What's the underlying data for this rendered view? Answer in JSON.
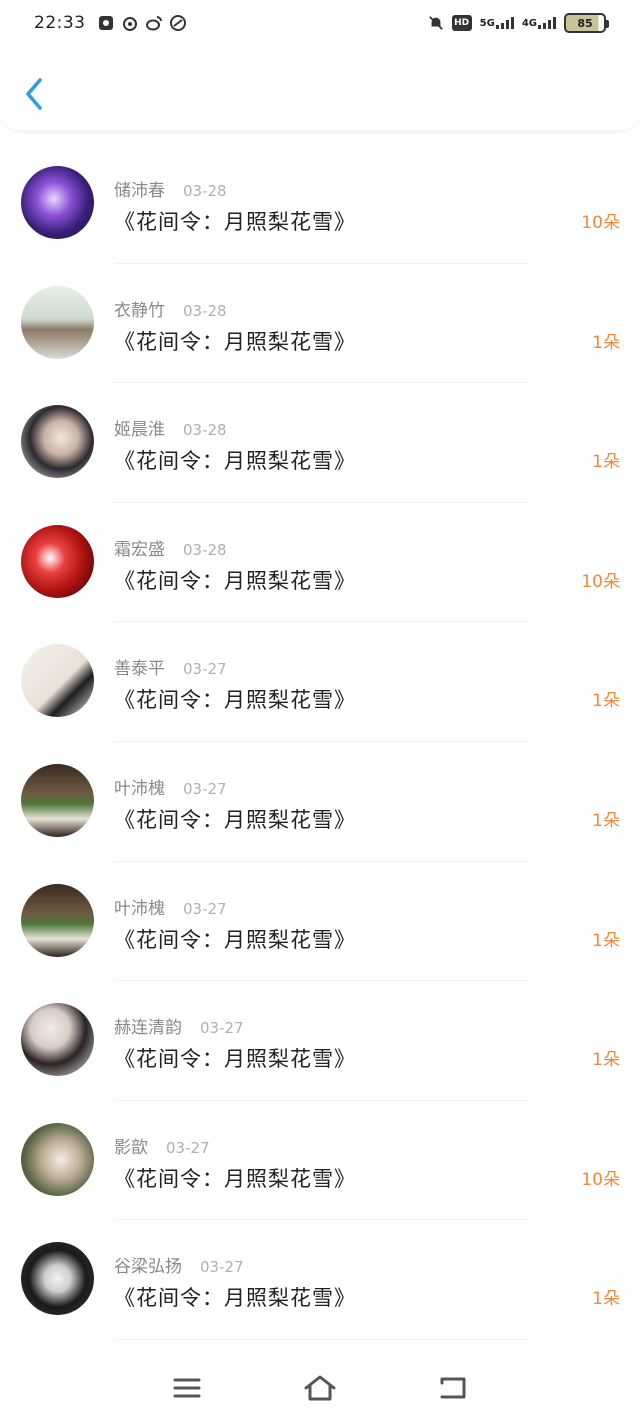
{
  "status_bar": {
    "time": "22:33",
    "left_icons": [
      "app-icon",
      "weibo-icon",
      "weibo-icon",
      "link-icon"
    ],
    "right_icons": [
      "mute-icon",
      "hd-icon"
    ],
    "signal_5g": "5G",
    "signal_4g": "4G",
    "battery": "85"
  },
  "header": {
    "back_icon": "chevron-left-icon"
  },
  "colors": {
    "accent_blue": "#2f9be0",
    "count_orange": "#f08a3c"
  },
  "list": [
    {
      "name": "储沛春",
      "date": "03-28",
      "title": "《花间令：月照梨花雪》",
      "count": "10朵"
    },
    {
      "name": "衣静竹",
      "date": "03-28",
      "title": "《花间令：月照梨花雪》",
      "count": "1朵"
    },
    {
      "name": "姬晨淮",
      "date": "03-28",
      "title": "《花间令：月照梨花雪》",
      "count": "1朵"
    },
    {
      "name": "霜宏盛",
      "date": "03-28",
      "title": "《花间令：月照梨花雪》",
      "count": "10朵"
    },
    {
      "name": "善泰平",
      "date": "03-27",
      "title": "《花间令：月照梨花雪》",
      "count": "1朵"
    },
    {
      "name": "叶沛槐",
      "date": "03-27",
      "title": "《花间令：月照梨花雪》",
      "count": "1朵"
    },
    {
      "name": "叶沛槐",
      "date": "03-27",
      "title": "《花间令：月照梨花雪》",
      "count": "1朵"
    },
    {
      "name": "赫连清韵",
      "date": "03-27",
      "title": "《花间令：月照梨花雪》",
      "count": "1朵"
    },
    {
      "name": "影歆",
      "date": "03-27",
      "title": "《花间令：月照梨花雪》",
      "count": "10朵"
    },
    {
      "name": "谷梁弘扬",
      "date": "03-27",
      "title": "《花间令：月照梨花雪》",
      "count": "1朵"
    }
  ],
  "bottom_nav": [
    "menu-icon",
    "home-icon",
    "back-icon"
  ]
}
